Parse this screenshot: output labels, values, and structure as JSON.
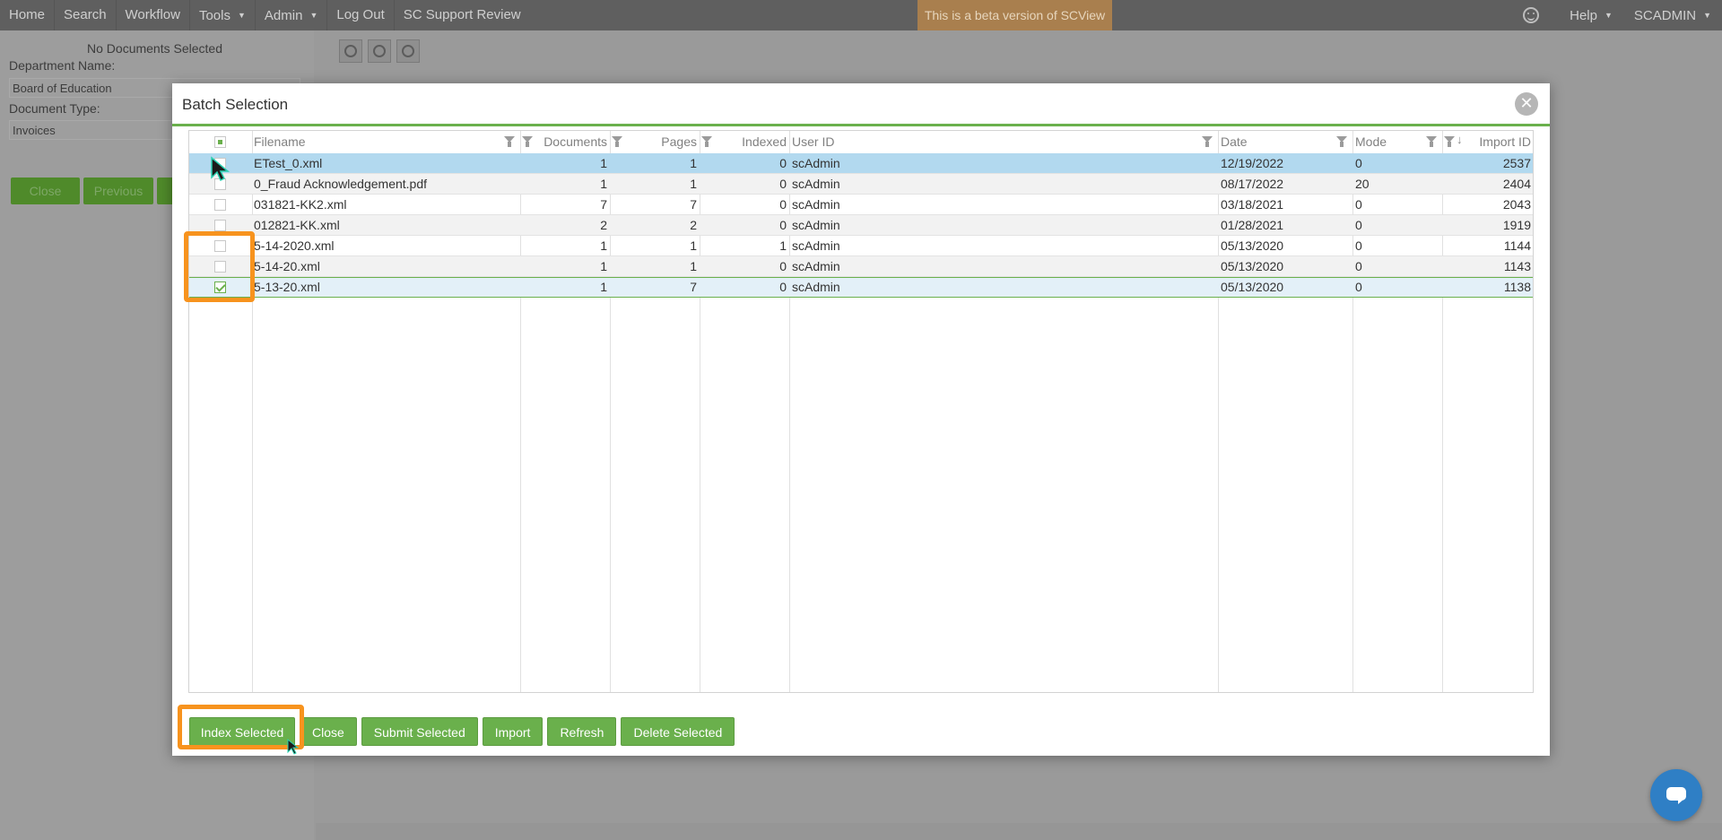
{
  "nav": {
    "items": [
      "Home",
      "Search",
      "Workflow",
      "Tools",
      "Admin",
      "Log Out",
      "SC Support Review"
    ],
    "beta_banner": "This is a beta version of SCView",
    "help_label": "Help",
    "user_label": "SCADMIN"
  },
  "left_panel": {
    "status": "No Documents Selected",
    "department_label": "Department Name:",
    "department_value": "Board of Education",
    "doctype_label": "Document Type:",
    "doctype_value": "Invoices",
    "buttons": [
      "Close",
      "Previous"
    ]
  },
  "modal": {
    "title": "Batch Selection",
    "columns": [
      "Filename",
      "Documents",
      "Pages",
      "Indexed",
      "User ID",
      "Date",
      "Mode",
      "Import ID"
    ],
    "rows": [
      {
        "filename": "ETest_0.xml",
        "documents": "1",
        "pages": "1",
        "indexed": "0",
        "user": "scAdmin",
        "date": "12/19/2022",
        "mode": "0",
        "import_id": "2537"
      },
      {
        "filename": "0_Fraud Acknowledgement.pdf",
        "documents": "1",
        "pages": "1",
        "indexed": "0",
        "user": "scAdmin",
        "date": "08/17/2022",
        "mode": "20",
        "import_id": "2404"
      },
      {
        "filename": "031821-KK2.xml",
        "documents": "7",
        "pages": "7",
        "indexed": "0",
        "user": "scAdmin",
        "date": "03/18/2021",
        "mode": "0",
        "import_id": "2043"
      },
      {
        "filename": "012821-KK.xml",
        "documents": "2",
        "pages": "2",
        "indexed": "0",
        "user": "scAdmin",
        "date": "01/28/2021",
        "mode": "0",
        "import_id": "1919"
      },
      {
        "filename": "5-14-2020.xml",
        "documents": "1",
        "pages": "1",
        "indexed": "1",
        "user": "scAdmin",
        "date": "05/13/2020",
        "mode": "0",
        "import_id": "1144"
      },
      {
        "filename": "5-14-20.xml",
        "documents": "1",
        "pages": "1",
        "indexed": "0",
        "user": "scAdmin",
        "date": "05/13/2020",
        "mode": "0",
        "import_id": "1143"
      },
      {
        "filename": "5-13-20.xml",
        "documents": "1",
        "pages": "7",
        "indexed": "0",
        "user": "scAdmin",
        "date": "05/13/2020",
        "mode": "0",
        "import_id": "1138"
      }
    ],
    "buttons": {
      "index_selected": "Index Selected",
      "close": "Close",
      "submit_selected": "Submit Selected",
      "import": "Import",
      "refresh": "Refresh",
      "delete_selected": "Delete Selected"
    }
  }
}
